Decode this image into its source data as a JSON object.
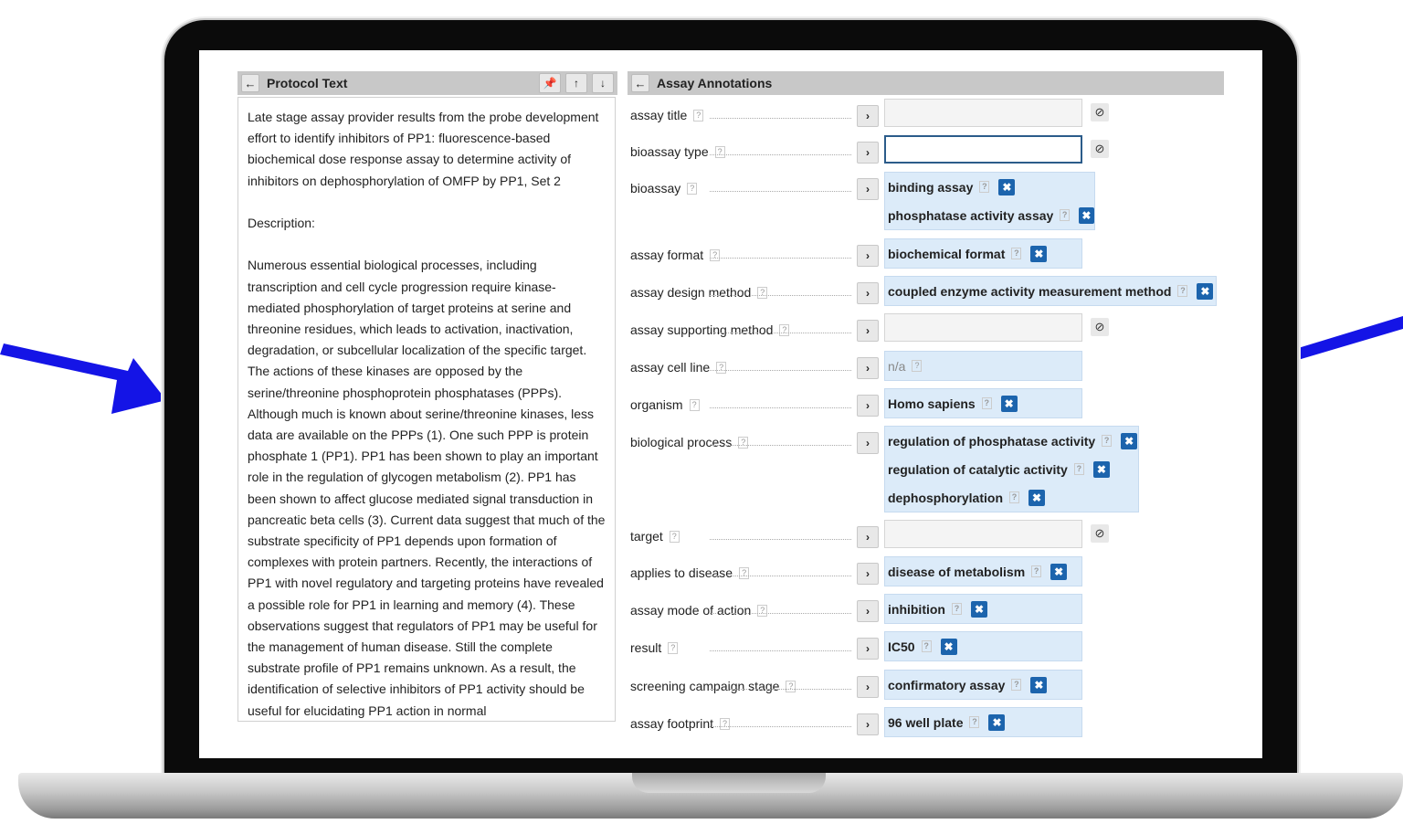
{
  "left_panel": {
    "title": "Protocol Text",
    "protocol_text": "Late stage assay provider results from the probe development effort to identify inhibitors of PP1: fluorescence-based biochemical dose response assay to determine activity of inhibitors on dephosphorylation of OMFP by PP1, Set 2\n\nDescription:\n\nNumerous essential biological processes, including transcription and cell cycle progression require kinase-mediated phosphorylation of target proteins at serine and threonine residues, which leads to activation, inactivation, degradation, or subcellular localization of the specific target. The actions of these kinases are opposed by the serine/threonine phosphoprotein phosphatases (PPPs). Although much is known about serine/threonine kinases, less data are available on the PPPs (1). One such PPP is protein phosphate 1 (PP1). PP1 has been shown to play an important role in the regulation of glycogen metabolism (2). PP1 has been shown to affect glucose mediated signal transduction in pancreatic beta cells (3). Current data suggest that much of the substrate specificity of PP1 depends upon formation of complexes with protein partners. Recently, the interactions of PP1 with novel regulatory and targeting proteins have revealed a possible role for PP1 in learning and memory (4). These observations suggest that regulators of PP1 may be useful for the management of human disease. Still the complete substrate profile of PP1 remains unknown. As a result, the identification of selective inhibitors of PP1 activity should be useful for elucidating PP1 action in normal"
  },
  "right_panel": {
    "title": "Assay Annotations",
    "help": "?",
    "remove": "✖",
    "annotations": [
      {
        "label": "assay title",
        "values": [],
        "state": "empty"
      },
      {
        "label": "bioassay type",
        "values": [],
        "state": "focus"
      },
      {
        "label": "bioassay",
        "values": [
          "binding assay",
          "phosphatase activity assay"
        ],
        "state": "filled"
      },
      {
        "label": "assay format",
        "values": [
          "biochemical format"
        ],
        "state": "filled"
      },
      {
        "label": "assay design method",
        "values": [
          "coupled enzyme activity measurement method"
        ],
        "state": "filled"
      },
      {
        "label": "assay supporting method",
        "values": [],
        "state": "empty"
      },
      {
        "label": "assay cell line",
        "values": [
          "n/a"
        ],
        "state": "na"
      },
      {
        "label": "organism",
        "values": [
          "Homo sapiens"
        ],
        "state": "filled"
      },
      {
        "label": "biological process",
        "values": [
          "regulation of phosphatase activity",
          "regulation of catalytic activity",
          "dephosphorylation"
        ],
        "state": "filled"
      },
      {
        "label": "target",
        "values": [],
        "state": "empty"
      },
      {
        "label": "applies to disease",
        "values": [
          "disease of metabolism"
        ],
        "state": "filled"
      },
      {
        "label": "assay mode of action",
        "values": [
          "inhibition"
        ],
        "state": "filled"
      },
      {
        "label": "result",
        "values": [
          "IC50"
        ],
        "state": "filled"
      },
      {
        "label": "screening campaign stage",
        "values": [
          "confirmatory assay"
        ],
        "state": "filled"
      },
      {
        "label": "assay footprint",
        "values": [
          "96 well plate"
        ],
        "state": "filled"
      }
    ]
  },
  "icons": {
    "back": "arrow-left-icon",
    "pin": "pin-icon",
    "up": "arrow-up-icon",
    "down": "arrow-down-icon",
    "expand": "chevron-right-icon",
    "clear": "clear-circle-icon",
    "remove": "remove-x-icon"
  },
  "colors": {
    "accent": "#1c64ad",
    "value_bg": "#dcebf9",
    "header_bg": "#c8c8c8",
    "arrow": "#1414e6"
  }
}
